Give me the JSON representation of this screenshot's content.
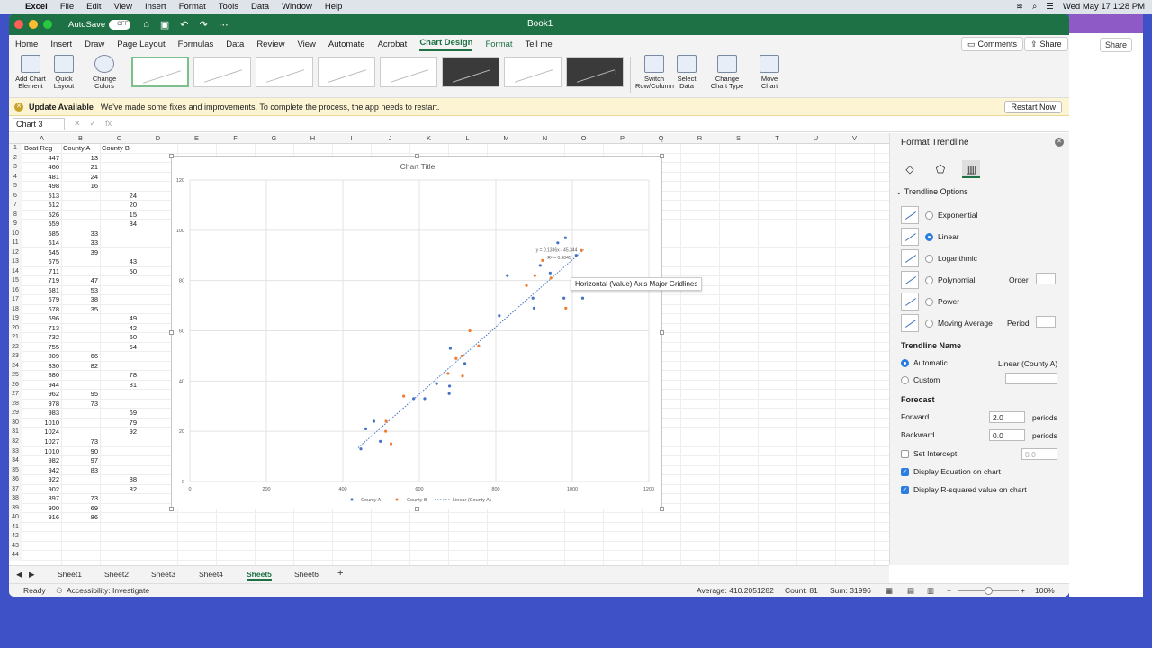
{
  "menubar": {
    "app": "Excel",
    "items": [
      "File",
      "Edit",
      "View",
      "Insert",
      "Format",
      "Tools",
      "Data",
      "Window",
      "Help"
    ],
    "datetime": "Wed May 17  1:28 PM"
  },
  "title": {
    "autosave": "AutoSave",
    "toggle": "OFF",
    "book": "Book1"
  },
  "tabs": [
    "Home",
    "Insert",
    "Draw",
    "Page Layout",
    "Formulas",
    "Data",
    "Review",
    "View",
    "Automate",
    "Acrobat",
    "Chart Design",
    "Format",
    "Tell me"
  ],
  "active_tab": "Chart Design",
  "ribbon_right": {
    "comments": "Comments",
    "share": "Share"
  },
  "ribbon": {
    "add_chart_element": [
      "Add Chart",
      "Element"
    ],
    "quick_layout": [
      "Quick",
      "Layout"
    ],
    "change_colors": [
      "Change",
      "Colors"
    ],
    "switch": [
      "Switch",
      "Row/Column"
    ],
    "select_data": [
      "Select",
      "Data"
    ],
    "change_type": [
      "Change",
      "Chart Type"
    ],
    "move_chart": [
      "Move",
      "Chart"
    ]
  },
  "update": {
    "title": "Update Available",
    "message": "We've made some fixes and improvements. To complete the process, the app needs to restart.",
    "button": "Restart Now"
  },
  "namebox": "Chart 3",
  "columns": [
    "A",
    "B",
    "C",
    "D",
    "E",
    "F",
    "G",
    "H",
    "I",
    "J",
    "K",
    "L",
    "M",
    "N",
    "O",
    "P",
    "Q",
    "R",
    "S",
    "T",
    "U",
    "V"
  ],
  "headers": [
    "Boat Reg",
    "County A",
    "County B"
  ],
  "rows": [
    [
      447,
      13,
      null
    ],
    [
      460,
      21,
      null
    ],
    [
      481,
      24,
      null
    ],
    [
      498,
      16,
      null
    ],
    [
      513,
      null,
      24
    ],
    [
      512,
      null,
      20
    ],
    [
      526,
      null,
      15
    ],
    [
      559,
      null,
      34
    ],
    [
      585,
      33,
      null
    ],
    [
      614,
      33,
      null
    ],
    [
      645,
      39,
      null
    ],
    [
      675,
      null,
      43
    ],
    [
      711,
      null,
      50
    ],
    [
      719,
      47,
      null
    ],
    [
      681,
      53,
      null
    ],
    [
      679,
      38,
      null
    ],
    [
      678,
      35,
      null
    ],
    [
      696,
      null,
      49
    ],
    [
      713,
      null,
      42
    ],
    [
      732,
      null,
      60
    ],
    [
      755,
      null,
      54
    ],
    [
      809,
      66,
      null
    ],
    [
      830,
      82,
      null
    ],
    [
      880,
      null,
      78
    ],
    [
      944,
      null,
      81
    ],
    [
      962,
      95,
      null
    ],
    [
      978,
      73,
      null
    ],
    [
      983,
      null,
      69
    ],
    [
      1010,
      null,
      79
    ],
    [
      1024,
      null,
      92
    ],
    [
      1027,
      73,
      null
    ],
    [
      1010,
      90,
      null
    ],
    [
      982,
      97,
      null
    ],
    [
      942,
      83,
      null
    ],
    [
      922,
      null,
      88
    ],
    [
      902,
      null,
      82
    ],
    [
      897,
      73,
      null
    ],
    [
      900,
      69,
      null
    ],
    [
      916,
      86,
      null
    ]
  ],
  "chart_data": {
    "type": "scatter",
    "title": "Chart Title",
    "xlim": [
      0,
      1200
    ],
    "ylim": [
      0,
      120
    ],
    "xticks": [
      0,
      200,
      400,
      600,
      800,
      1000,
      1200
    ],
    "yticks": [
      0,
      20,
      40,
      60,
      80,
      100,
      120
    ],
    "series": [
      {
        "name": "County A",
        "color": "#4472c4",
        "x": [
          447,
          460,
          481,
          498,
          585,
          614,
          645,
          719,
          681,
          679,
          678,
          809,
          830,
          962,
          978,
          1027,
          1010,
          982,
          942,
          897,
          900,
          916
        ],
        "y": [
          13,
          21,
          24,
          16,
          33,
          33,
          39,
          47,
          53,
          38,
          35,
          66,
          82,
          95,
          73,
          73,
          90,
          97,
          83,
          73,
          69,
          86
        ]
      },
      {
        "name": "County B",
        "color": "#ed7d31",
        "x": [
          513,
          512,
          526,
          559,
          675,
          711,
          696,
          713,
          732,
          755,
          880,
          944,
          983,
          1010,
          1024,
          922,
          902
        ],
        "y": [
          24,
          20,
          15,
          34,
          43,
          50,
          49,
          42,
          60,
          54,
          78,
          81,
          69,
          79,
          92,
          88,
          82
        ]
      }
    ],
    "trendline": {
      "name": "Linear (County A)",
      "slope": 0.1336,
      "intercept": -45.344,
      "equation": "y = 0.1336x - 45.344",
      "r2": "R² = 0.9045",
      "x_end": 1030,
      "color": "#4472c4"
    },
    "grid": true,
    "legend": "bottom"
  },
  "tooltip": "Horizontal (Value) Axis Major Gridlines",
  "sheets": [
    "Sheet1",
    "Sheet2",
    "Sheet3",
    "Sheet4",
    "Sheet5",
    "Sheet6"
  ],
  "active_sheet": "Sheet5",
  "status": {
    "ready": "Ready",
    "accessibility": "Accessibility: Investigate",
    "average": "Average: 410.2051282",
    "count": "Count: 81",
    "sum": "Sum: 31996",
    "zoom": "100%"
  },
  "panel": {
    "title": "Format Trendline",
    "options_header": "Trendline Options",
    "types": [
      "Exponential",
      "Linear",
      "Logarithmic",
      "Polynomial",
      "Power",
      "Moving Average"
    ],
    "selected_type": "Linear",
    "order_label": "Order",
    "period_label": "Period",
    "name_header": "Trendline Name",
    "automatic": "Automatic",
    "automatic_value": "Linear (County A)",
    "custom": "Custom",
    "forecast_header": "Forecast",
    "forward": "Forward",
    "forward_value": "2.0",
    "backward": "Backward",
    "backward_value": "0.0",
    "periods": "periods",
    "set_intercept": "Set Intercept",
    "intercept_value": "0.0",
    "display_eq": "Display Equation on chart",
    "display_r2": "Display R-squared value on chart"
  }
}
